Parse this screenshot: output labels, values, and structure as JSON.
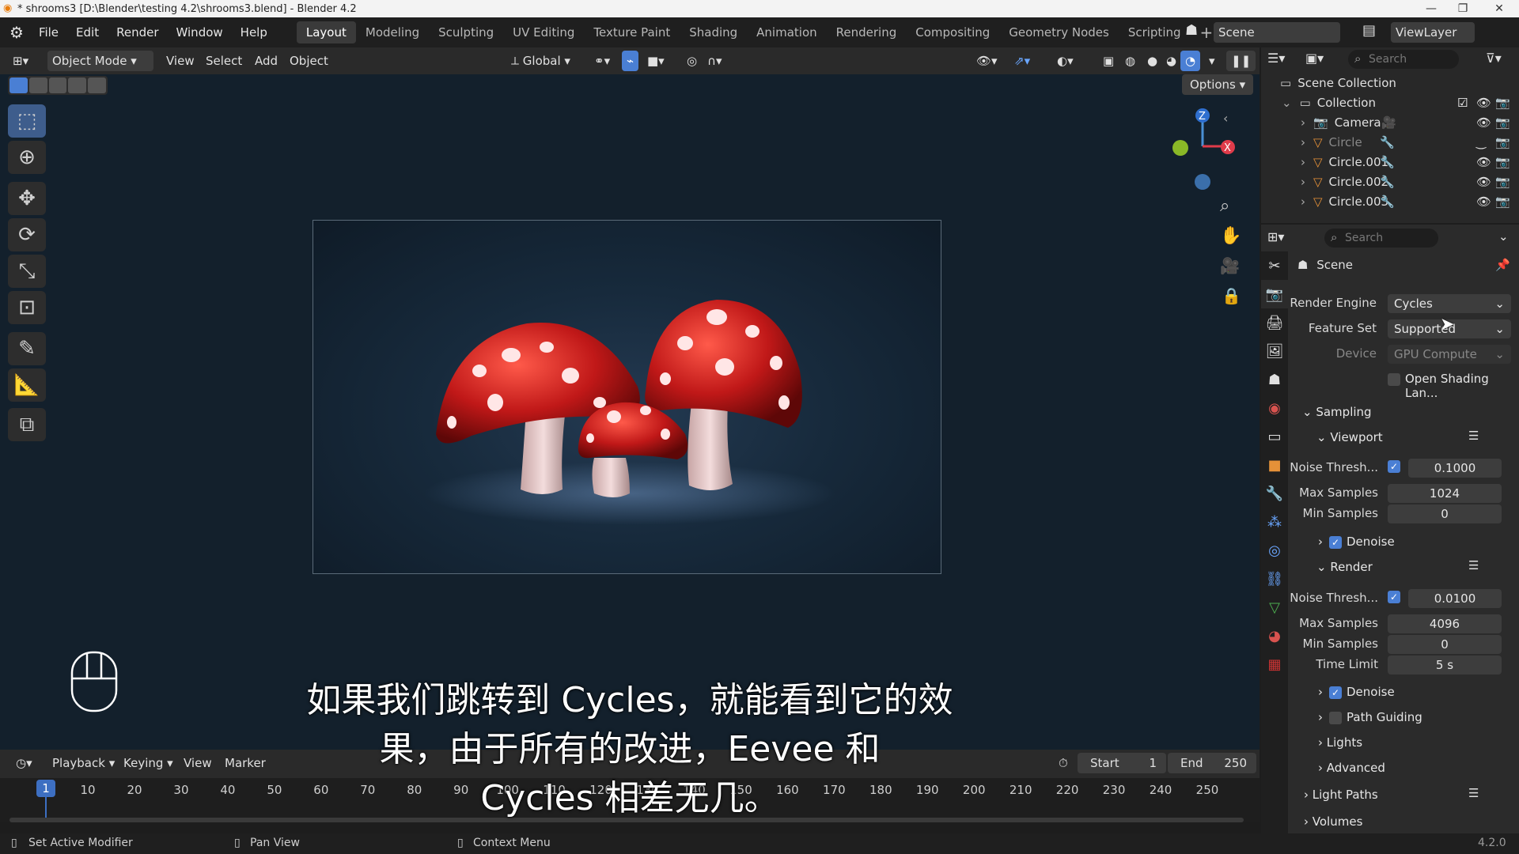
{
  "window": {
    "title": "* shrooms3 [D:\\Blender\\testing 4.2\\shrooms3.blend] - Blender 4.2"
  },
  "menu": [
    "File",
    "Edit",
    "Render",
    "Window",
    "Help"
  ],
  "workspaces": [
    "Layout",
    "Modeling",
    "Sculpting",
    "UV Editing",
    "Texture Paint",
    "Shading",
    "Animation",
    "Rendering",
    "Compositing",
    "Geometry Nodes",
    "Scripting"
  ],
  "active_workspace": "Layout",
  "scene_selector": {
    "scene": "Scene",
    "view_layer": "ViewLayer"
  },
  "viewport_header": {
    "mode": "Object Mode",
    "menus": [
      "View",
      "Select",
      "Add",
      "Object"
    ],
    "transform": "Global",
    "options": "Options"
  },
  "outliner": {
    "search_placeholder": "Search",
    "root": "Scene Collection",
    "collection": "Collection",
    "items": [
      "Camera",
      "Circle",
      "Circle.001",
      "Circle.002",
      "Circle.003"
    ]
  },
  "properties": {
    "search_placeholder": "Search",
    "context": "Scene",
    "render_engine_label": "Render Engine",
    "render_engine": "Cycles",
    "feature_set_label": "Feature Set",
    "feature_set": "Supported",
    "device_label": "Device",
    "device": "GPU Compute",
    "osl_label": "Open Shading Lan...",
    "sampling": "Sampling",
    "viewport": {
      "title": "Viewport",
      "noise_label": "Noise Thresh...",
      "noise": "0.1000",
      "max_label": "Max Samples",
      "max": "1024",
      "min_label": "Min Samples",
      "min": "0",
      "denoise": "Denoise"
    },
    "render": {
      "title": "Render",
      "noise_label": "Noise Thresh...",
      "noise": "0.0100",
      "max_label": "Max Samples",
      "max": "4096",
      "min_label": "Min Samples",
      "min": "0",
      "time_label": "Time Limit",
      "time": "5 s",
      "denoise": "Denoise",
      "path_guiding": "Path Guiding",
      "lights": "Lights",
      "advanced": "Advanced"
    },
    "light_paths": "Light Paths",
    "volumes": "Volumes"
  },
  "subtitles": [
    "如果我们跳转到 Cycles，就能看到它的效",
    "果，由于所有的改进，Eevee 和",
    "Cycles 相差无几。"
  ],
  "timeline": {
    "menus": [
      "Playback",
      "Keying",
      "View",
      "Marker"
    ],
    "current_frame": "1",
    "start_label": "Start",
    "start": "1",
    "end_label": "End",
    "end": "250",
    "frames": [
      "10",
      "20",
      "30",
      "40",
      "50",
      "60",
      "70",
      "80",
      "90",
      "100",
      "110",
      "120",
      "130",
      "140",
      "150",
      "160",
      "170",
      "180",
      "190",
      "200",
      "210",
      "220",
      "230",
      "240",
      "250"
    ]
  },
  "statusbar": {
    "left": "Set Active Modifier",
    "mid": "Pan View",
    "right": "Context Menu",
    "version": "4.2.0"
  },
  "colors": {
    "accent": "#4a7fd4",
    "active_frame": "#3d6fc2",
    "mushroom_red": "#c01818"
  }
}
